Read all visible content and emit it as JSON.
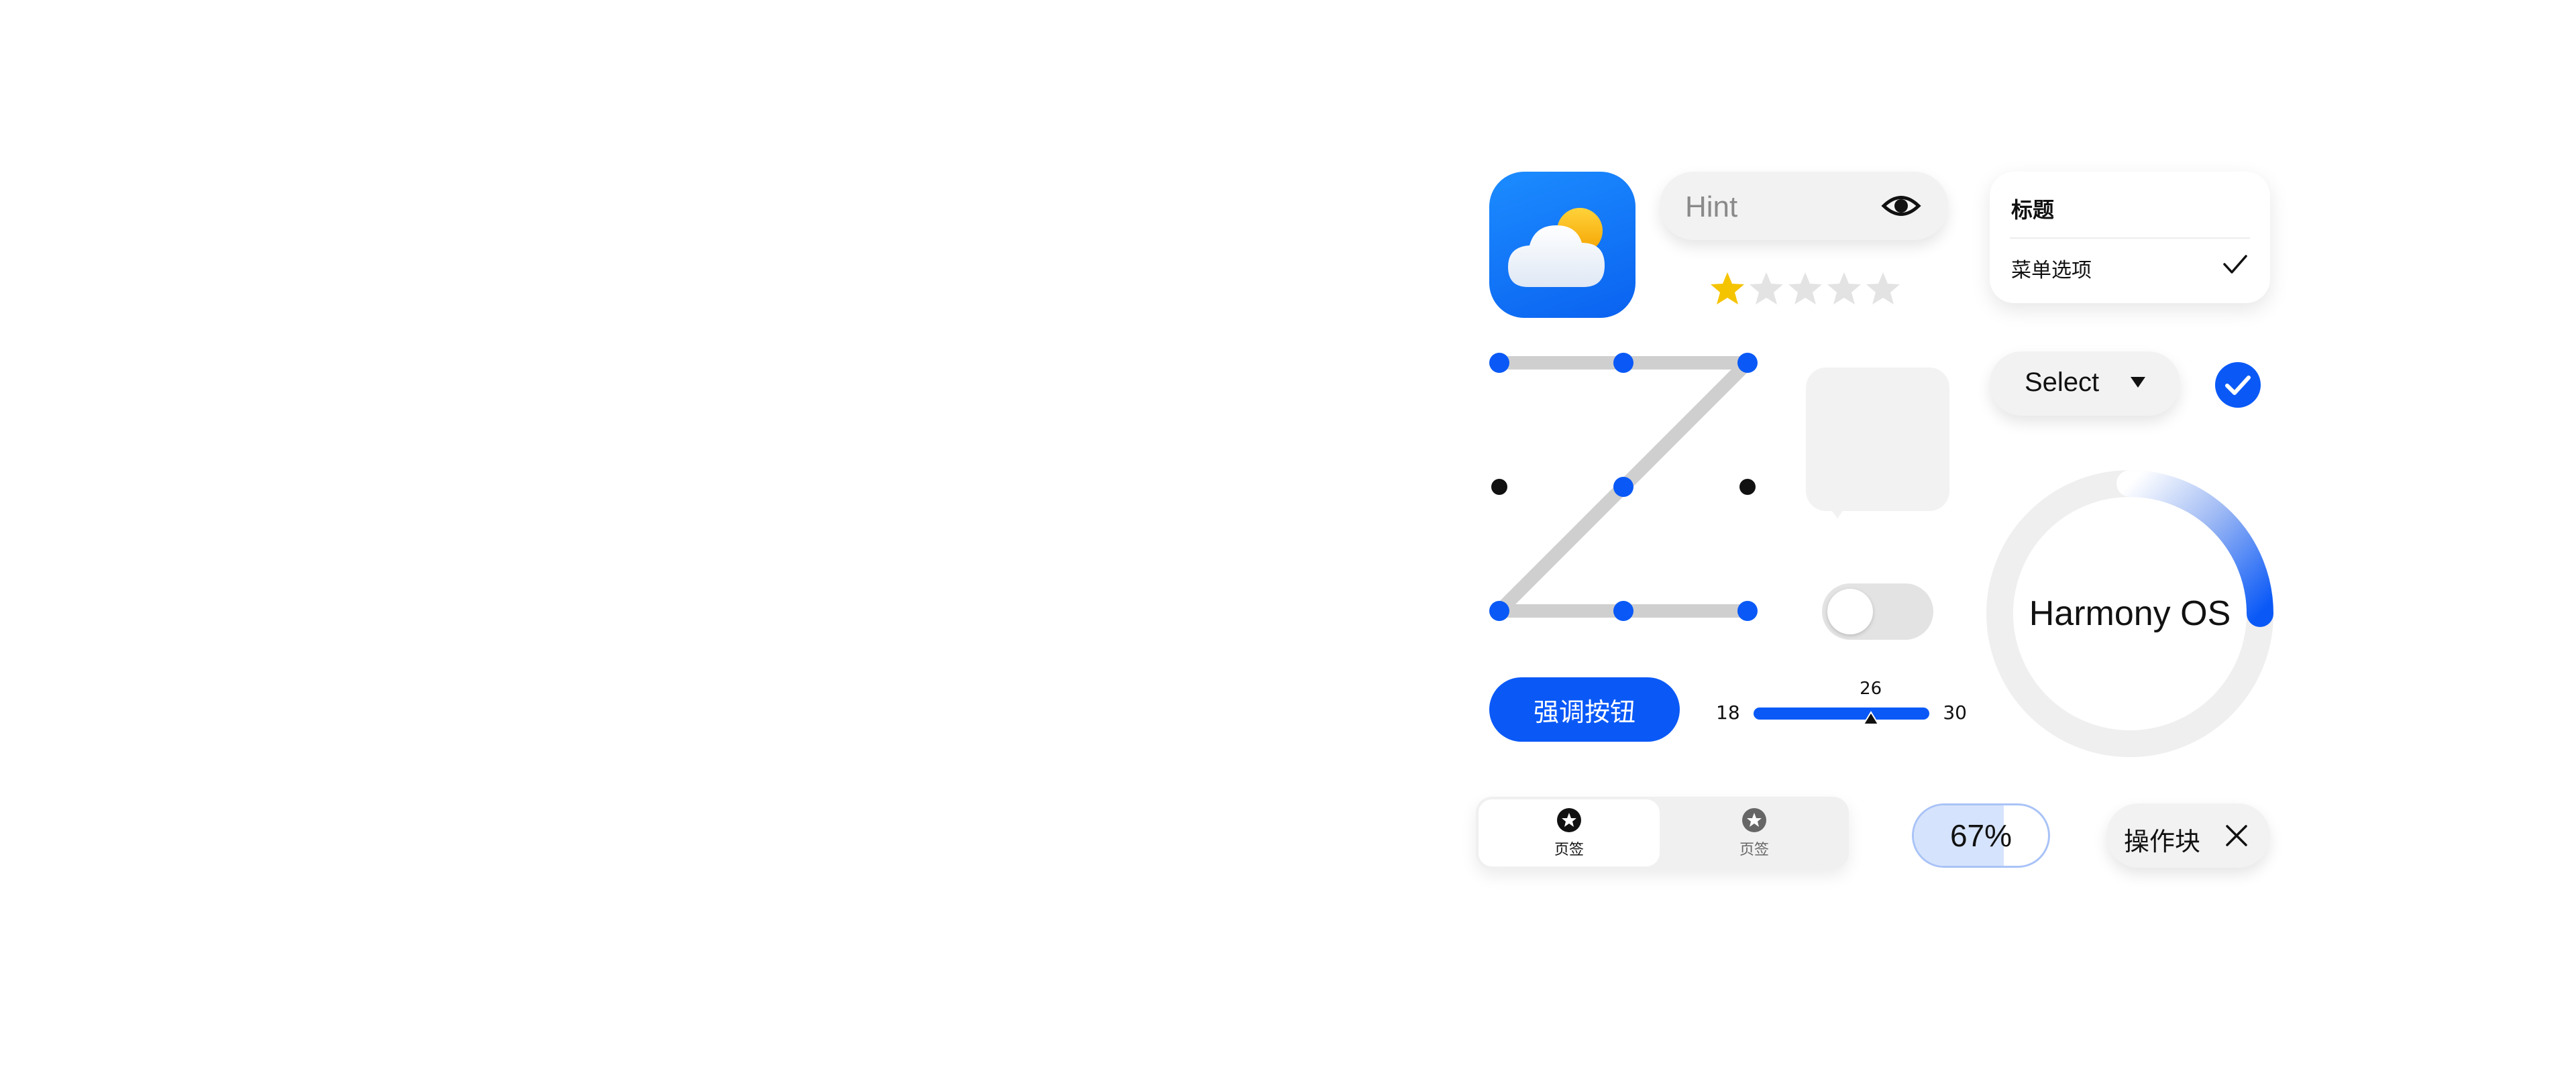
{
  "password_field": {
    "placeholder": "Hint",
    "icon": "eye-icon"
  },
  "rating": {
    "value": 1,
    "max": 5,
    "active_color": "#f5c400",
    "inactive_color": "#e3e3e3"
  },
  "menu": {
    "title": "标题",
    "item_label": "菜单选项",
    "item_checked": true
  },
  "select": {
    "label": "Select"
  },
  "checkbox": {
    "checked": true,
    "color": "#0a59f7"
  },
  "progress_ring": {
    "label": "Harmony OS",
    "value": 0.25,
    "color": "#0a59f7"
  },
  "emphasis_button": {
    "label": "强调按钮",
    "color": "#0a59f7"
  },
  "slider": {
    "min_label": "18",
    "max_label": "30",
    "value_label": "26",
    "min": 18,
    "max": 30,
    "value": 26
  },
  "tabs": [
    {
      "label": "页签",
      "active": true
    },
    {
      "label": "页签",
      "active": false
    }
  ],
  "progress_capsule": {
    "label": "67%",
    "value": 0.67
  },
  "chip": {
    "label": "操作块",
    "icon": "close-icon"
  },
  "toggle": {
    "on": false
  },
  "colors": {
    "accent": "#0a59f7",
    "surface": "#f2f2f2",
    "track": "#cfcfcf"
  }
}
